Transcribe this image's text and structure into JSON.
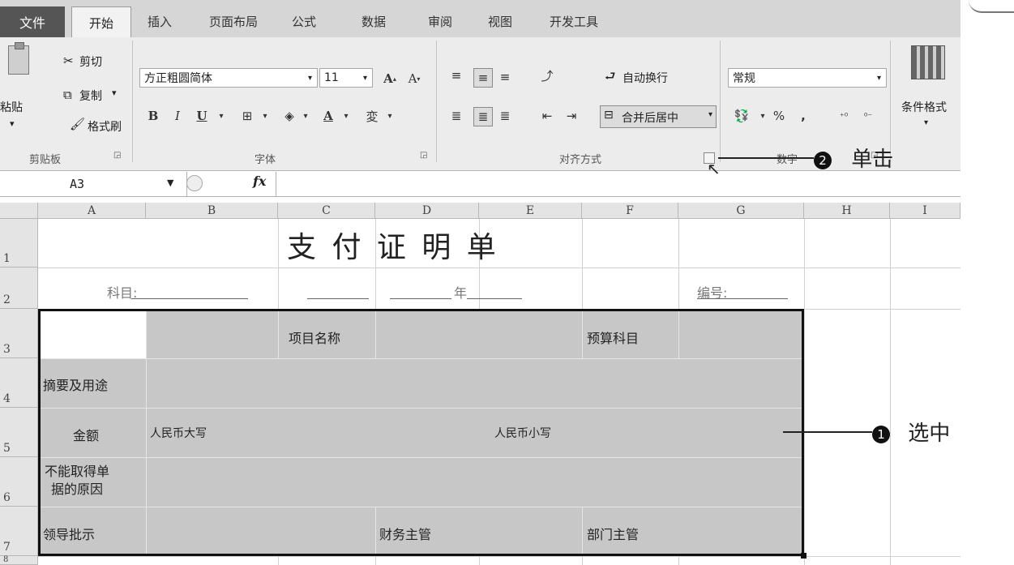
{
  "ribbon_tabs": {
    "file": "文件",
    "home": "开始",
    "insert": "插入",
    "page_layout": "页面布局",
    "formulas": "公式",
    "data": "数据",
    "review": "审阅",
    "view": "视图",
    "developer": "开发工具"
  },
  "clipboard": {
    "paste": "粘贴",
    "cut": "剪切",
    "copy": "复制",
    "format_painter": "格式刷",
    "group_label": "剪贴板"
  },
  "font": {
    "font_name": "方正粗圆简体",
    "font_size": "11",
    "bold": "B",
    "italic": "I",
    "underline": "U",
    "group_label": "字体"
  },
  "alignment": {
    "wrap_text": "自动换行",
    "merge_center": "合并后居中",
    "group_label": "对齐方式"
  },
  "number": {
    "format": "常规",
    "percent": "%",
    "comma": ",",
    "group_label": "数字"
  },
  "styles": {
    "conditional_format": "条件格式"
  },
  "formula_bar": {
    "name_box": "A3",
    "fx": "fx"
  },
  "columns": [
    "A",
    "B",
    "C",
    "D",
    "E",
    "F",
    "G",
    "H",
    "I"
  ],
  "rows": [
    "1",
    "2",
    "3",
    "4",
    "5",
    "6",
    "7",
    "8"
  ],
  "sheet": {
    "title": "支 付 证 明 单",
    "subject_label": "科目:",
    "year_label": "年",
    "number_label": "编号:",
    "project_name": "项目名称",
    "budget_subject": "预算科目",
    "summary_usage": "摘要及用途",
    "amount": "金额",
    "rmb_upper": "人民币大写",
    "rmb_lower": "人民币小写",
    "reason_line1": "不能取得单",
    "reason_line2": "据的原因",
    "leader_approval": "领导批示",
    "finance_supervisor": "财务主管",
    "dept_supervisor": "部门主管"
  },
  "callouts": {
    "step1_num": "1",
    "step1_text": "选中",
    "step2_num": "2",
    "step2_text": "单击"
  }
}
